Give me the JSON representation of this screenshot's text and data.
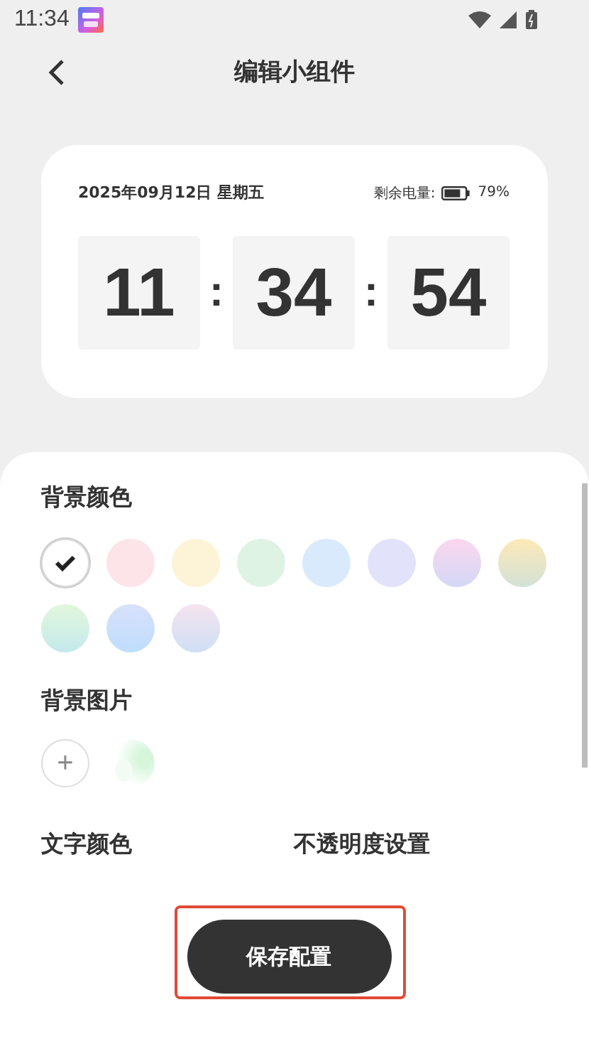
{
  "status_bar": {
    "time": "11:34"
  },
  "header": {
    "title": "编辑小组件"
  },
  "widget": {
    "date": "2025年09月12日 星期五",
    "battery_label": "剩余电量:",
    "battery_percent": "79%",
    "hours": "11",
    "minutes": "34",
    "seconds": "54",
    "separator": ":"
  },
  "background_color": {
    "title": "背景颜色",
    "swatches": [
      {
        "kind": "none",
        "selected": true
      },
      {
        "kind": "solid",
        "color": "#fde4e8",
        "selected": false
      },
      {
        "kind": "solid",
        "color": "#fdf4d8",
        "selected": false
      },
      {
        "kind": "solid",
        "color": "#dff3e4",
        "selected": false
      },
      {
        "kind": "solid",
        "color": "#d9eafc",
        "selected": false
      },
      {
        "kind": "solid",
        "color": "#e2e2fa",
        "selected": false
      },
      {
        "kind": "gradient",
        "color": "#fcd7ee",
        "selected": false
      },
      {
        "kind": "gradient",
        "color": "#fde9b6",
        "selected": false
      },
      {
        "kind": "gradient",
        "color": "#e2f7dc",
        "selected": false
      },
      {
        "kind": "gradient",
        "color": "#d8e1fb",
        "selected": false
      },
      {
        "kind": "gradient",
        "color": "#f5e4ee",
        "selected": false
      }
    ]
  },
  "background_image": {
    "title": "背景图片",
    "add": "+"
  },
  "text_color": {
    "title": "文字颜色"
  },
  "opacity": {
    "title": "不透明度设置"
  },
  "save_button": {
    "label": "保存配置",
    "highlighted": true
  }
}
